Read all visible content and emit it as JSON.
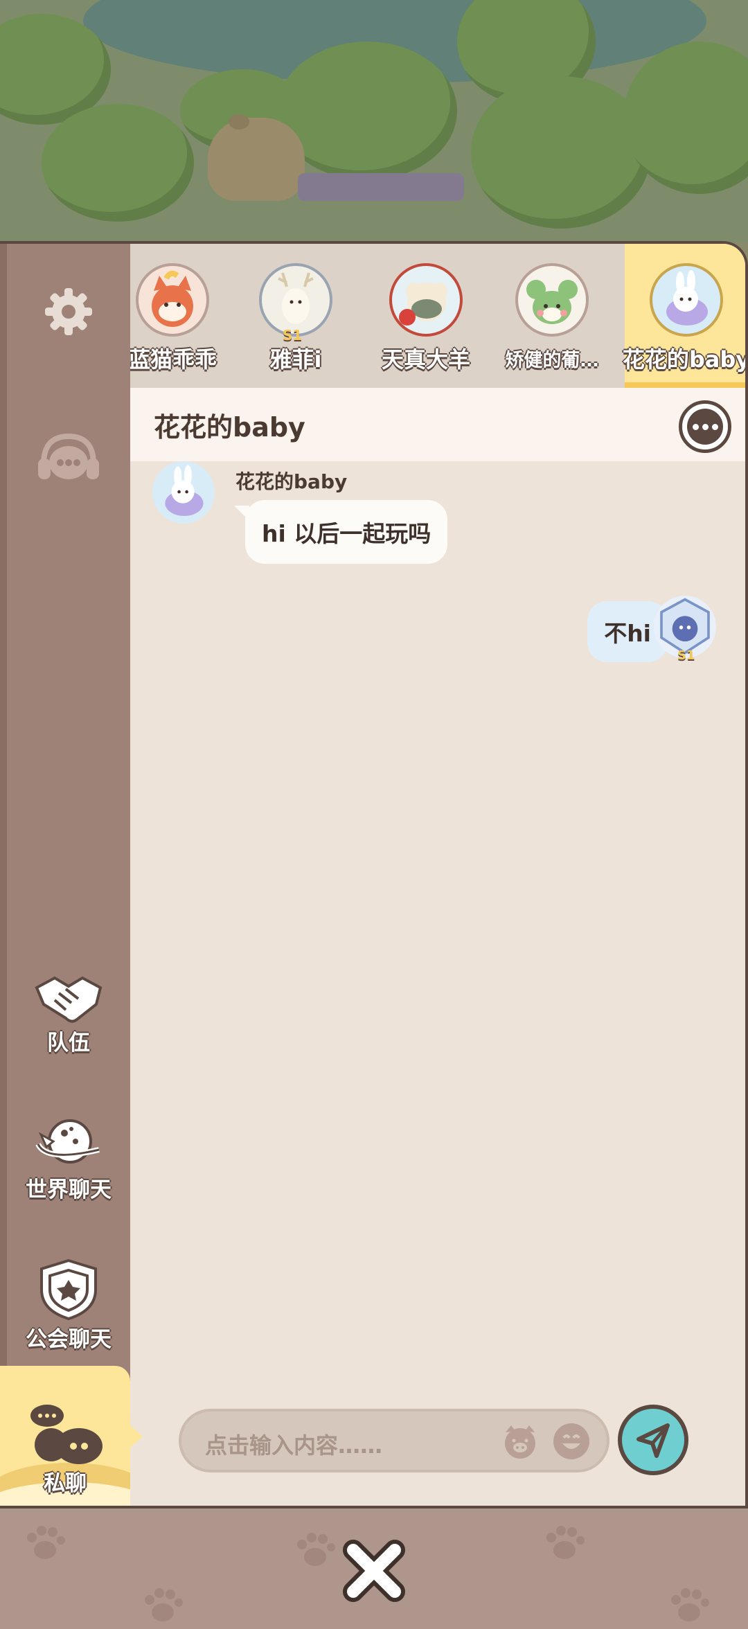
{
  "contacts": [
    {
      "name": "蓝猫乖乖",
      "active": false
    },
    {
      "name": "雅菲i",
      "active": false,
      "badge": "S1"
    },
    {
      "name": "天真大羊",
      "active": false
    },
    {
      "name": "矫健的葡…",
      "active": false
    },
    {
      "name": "花花的baby",
      "active": true
    }
  ],
  "chat": {
    "title": "花花的baby",
    "messages": [
      {
        "sender": "花花的baby",
        "text": "hi 以后一起玩吗",
        "side": "left"
      },
      {
        "text": "不hi",
        "side": "right",
        "badge": "S1"
      }
    ]
  },
  "sidebar": {
    "team_label": "队伍",
    "world_chat_label": "世界聊天",
    "guild_chat_label": "公会聊天",
    "private_chat_label": "私聊"
  },
  "input": {
    "placeholder": "点击输入内容……"
  },
  "colors": {
    "panel_bg": "#ede3d8",
    "sidebar_bg": "#9e8277",
    "active_tab": "#fde69a",
    "send_button": "#6fcfd0",
    "outline": "#5b4840"
  },
  "icons": [
    "settings-gear-icon",
    "customer-service-icon",
    "handshake-icon",
    "planet-icon",
    "guild-shield-icon",
    "chat-bubbles-icon",
    "more-dots-icon",
    "pig-sticker-icon",
    "emoji-icon",
    "send-arrow-icon",
    "close-x-icon"
  ]
}
